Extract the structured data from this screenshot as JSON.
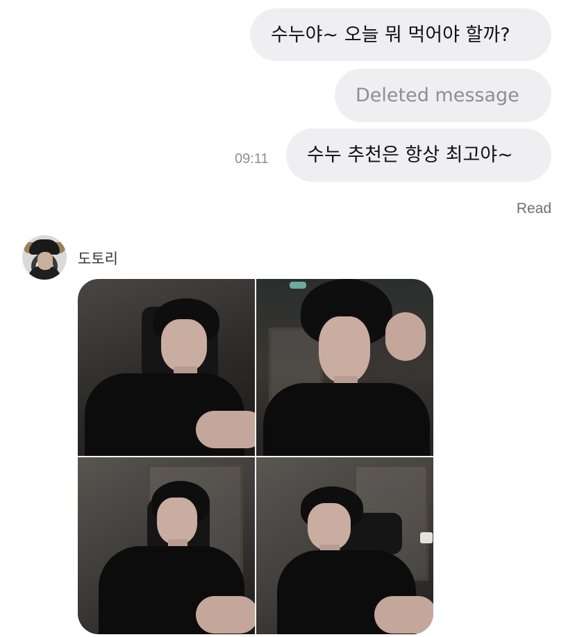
{
  "messages": {
    "outgoing": [
      {
        "text": "수누야~ 오늘 뭐 먹어야 할까?"
      },
      {
        "text": "Deleted message"
      },
      {
        "text": "수누 추천은 항상 최고야~",
        "time": "09:11"
      }
    ],
    "read_receipt": "Read"
  },
  "incoming": {
    "sender_name": "도토리",
    "photo_count": 4
  },
  "colors": {
    "bubble_bg": "#efeff1",
    "deleted_text": "#8e8e93",
    "meta_text": "#8e8e93"
  }
}
